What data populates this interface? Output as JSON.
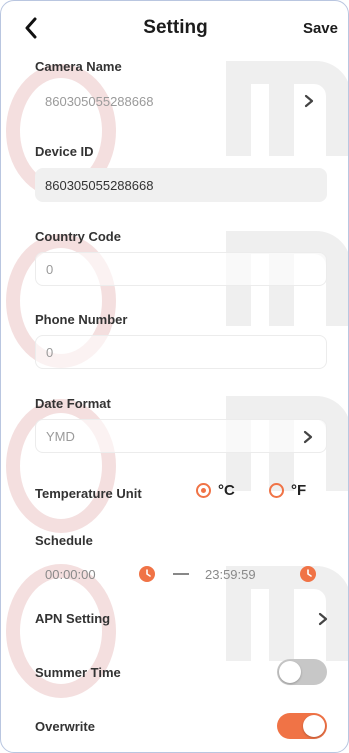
{
  "header": {
    "title": "Setting",
    "save_label": "Save"
  },
  "camera_name": {
    "label": "Camera Name",
    "value": "860305055288668"
  },
  "device_id": {
    "label": "Device ID",
    "value": "860305055288668"
  },
  "country_code": {
    "label": "Country Code",
    "placeholder": "0"
  },
  "phone_number": {
    "label": "Phone Number",
    "placeholder": "0"
  },
  "date_format": {
    "label": "Date Format",
    "value": "YMD"
  },
  "temperature_unit": {
    "label": "Temperature Unit",
    "options": [
      {
        "label": "°C",
        "selected": true
      },
      {
        "label": "°F",
        "selected": false
      }
    ]
  },
  "schedule": {
    "label": "Schedule",
    "start": "00:00:00",
    "end": "23:59:59"
  },
  "apn_setting": {
    "label": "APN Setting"
  },
  "summer_time": {
    "label": "Summer Time",
    "enabled": false
  },
  "overwrite": {
    "label": "Overwrite",
    "enabled": true
  },
  "colors": {
    "accent": "#f07346",
    "toggle_off": "#c7c7c7",
    "field_bg": "#f0f0f0"
  },
  "icons": [
    "chevron-left-icon",
    "chevron-right-icon",
    "clock-icon"
  ]
}
